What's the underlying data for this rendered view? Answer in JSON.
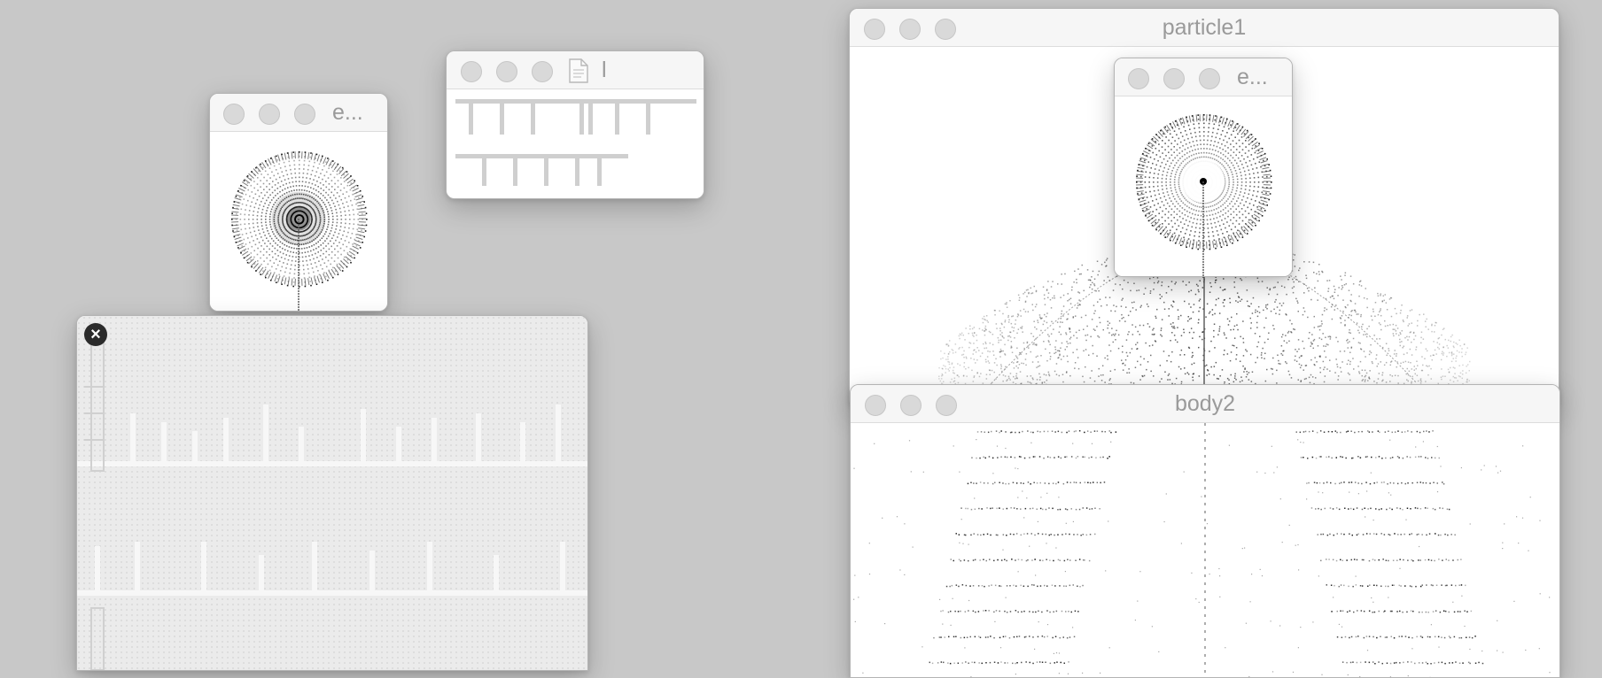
{
  "windows": {
    "particle1": {
      "title": "particle1"
    },
    "body2": {
      "title": "body2"
    },
    "emitter_small_left": {
      "title": "e..."
    },
    "emitter_small_right": {
      "title": "e..."
    },
    "text_window": {
      "title": "l"
    }
  },
  "icons": {
    "close_badge": "×",
    "document_icon": "document-icon"
  },
  "colors": {
    "desktop": "#c8c8c8",
    "titlebar": "#f6f6f6",
    "traffic_light_inactive": "#d9d9d9",
    "title_text": "#9a9a9a"
  }
}
